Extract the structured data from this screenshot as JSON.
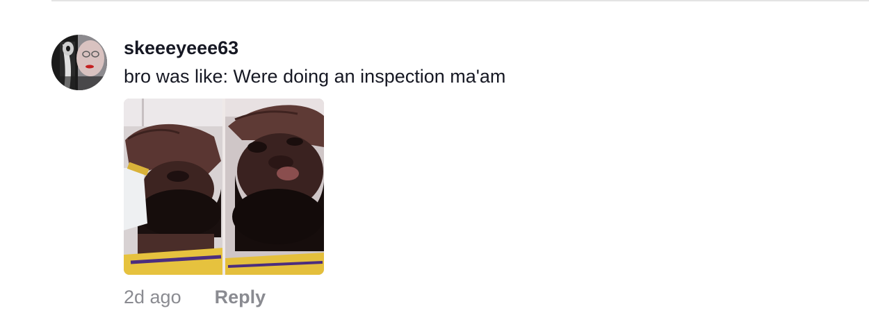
{
  "comment": {
    "username": "skeeeyeee63",
    "text": "bro was like: Were doing an inspection ma'am",
    "timestamp": "2d ago",
    "reply_label": "Reply"
  }
}
